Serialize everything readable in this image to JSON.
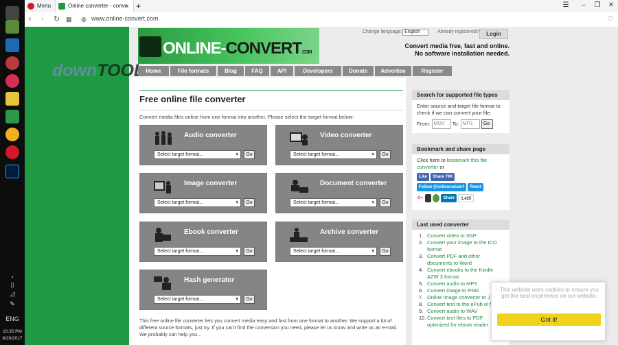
{
  "taskbar": {
    "lang": "ENG",
    "time": "10:35 PM",
    "date": "8/20/2017"
  },
  "browser": {
    "menu_label": "Menu",
    "tab_title": "Online converter - conve",
    "new_tab_icon": "+",
    "url": "www.online-convert.com"
  },
  "watermark": {
    "pre": "down",
    "brand": "TOOL"
  },
  "logo": {
    "part1": "ONLINE-",
    "part2": "CONVERT",
    "suffix": ".COM"
  },
  "header": {
    "change_language": "Change language:",
    "language": "English",
    "already_registered": "Already registered?",
    "login": "Login",
    "tagline1": "Convert media free, fast and online.",
    "tagline2": "No software installation needed."
  },
  "nav": [
    "Home",
    "File formats",
    "Blog",
    "FAQ",
    "API",
    "Developers",
    "Donate",
    "Advertise",
    "Register"
  ],
  "main": {
    "title": "Free online file converter",
    "intro": "Convert media files online from one format into another. Please select the target format below:",
    "converters": [
      {
        "name": "Audio converter",
        "icon": "audio-icon"
      },
      {
        "name": "Video converter",
        "icon": "video-icon"
      },
      {
        "name": "Image converter",
        "icon": "image-icon"
      },
      {
        "name": "Document converter",
        "icon": "document-icon"
      },
      {
        "name": "Ebook converter",
        "icon": "ebook-icon"
      },
      {
        "name": "Archive converter",
        "icon": "archive-icon"
      },
      {
        "name": "Hash generator",
        "icon": "hash-icon"
      }
    ],
    "select_placeholder": "Select target format...",
    "go": "Go",
    "bottom_text": "This free online file converter lets you convert media easy and fast from one format to another. We support a lot of different source formats, just try. If you can't find the conversion you need, please let us know and write us an e-mail. We probably can help you..."
  },
  "sidebar": {
    "search_title": "Search for supported file types",
    "search_desc": "Enter source and target file format to check if we can convert your file:",
    "from_label": "From:",
    "from_placeholder": "MOV",
    "to_label": "To:",
    "to_placeholder": "MP3",
    "go": "Go",
    "bookmark_title": "Bookmark and share page",
    "bookmark_pre": "Click here to ",
    "bookmark_link": "bookmark this file converter",
    "bookmark_post": " or",
    "like": "Like",
    "share": "Share 79K",
    "follow": "Follow @onlineconvert",
    "tweet": "Tweet",
    "gplus": "G+",
    "linkedin_share": "Share",
    "count": "1,425",
    "last_title": "Last used converter",
    "last_items": [
      "Convert video to 3GP",
      "Convert your image to the ICO format",
      "Convert PDF and other documents to Word",
      "Convert ebooks to the Kindle AZW 3 format",
      "Convert audio to MP3",
      "Convert image to PNG",
      "Online image converter to J",
      "Convert text to the ePub el format",
      "Convert audio to WAV",
      "Convert text files to PDF optimized for ebook reader"
    ]
  },
  "cookie": {
    "text": "This website uses cookies to ensure you get the best experience on our website.",
    "button": "Got it!"
  },
  "colors": {
    "green": "#1e9a45",
    "nav_gray": "#8a8a8a",
    "box_gray": "#858585",
    "cookie_yellow": "#f1d21b"
  }
}
